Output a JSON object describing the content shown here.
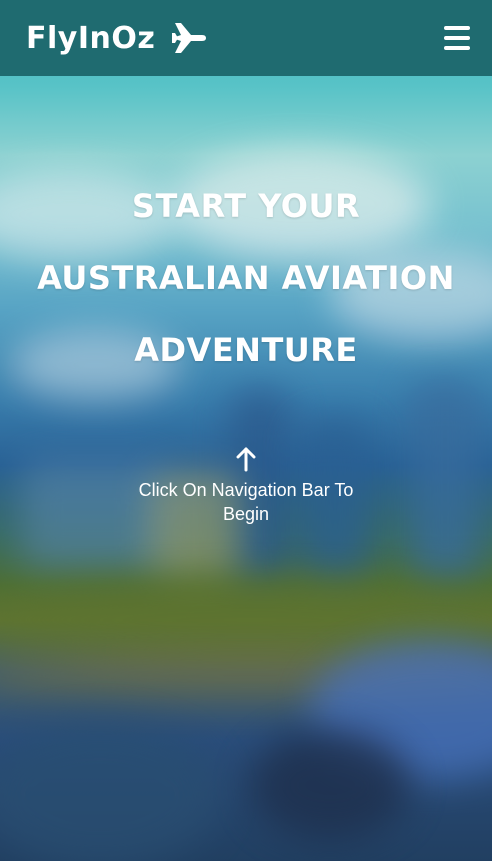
{
  "header": {
    "brand_name": "FlyInOz",
    "logo_icon": "plane-icon",
    "menu_icon": "hamburger-menu-icon"
  },
  "hero": {
    "headline_lines": [
      "START YOUR",
      "AUSTRALIAN AVIATION",
      "ADVENTURE"
    ],
    "hint_icon": "arrow-up-icon",
    "hint_text": "Click On Navigation Bar To Begin"
  },
  "colors": {
    "nav_background": "#1f6b70",
    "text": "#ffffff"
  }
}
